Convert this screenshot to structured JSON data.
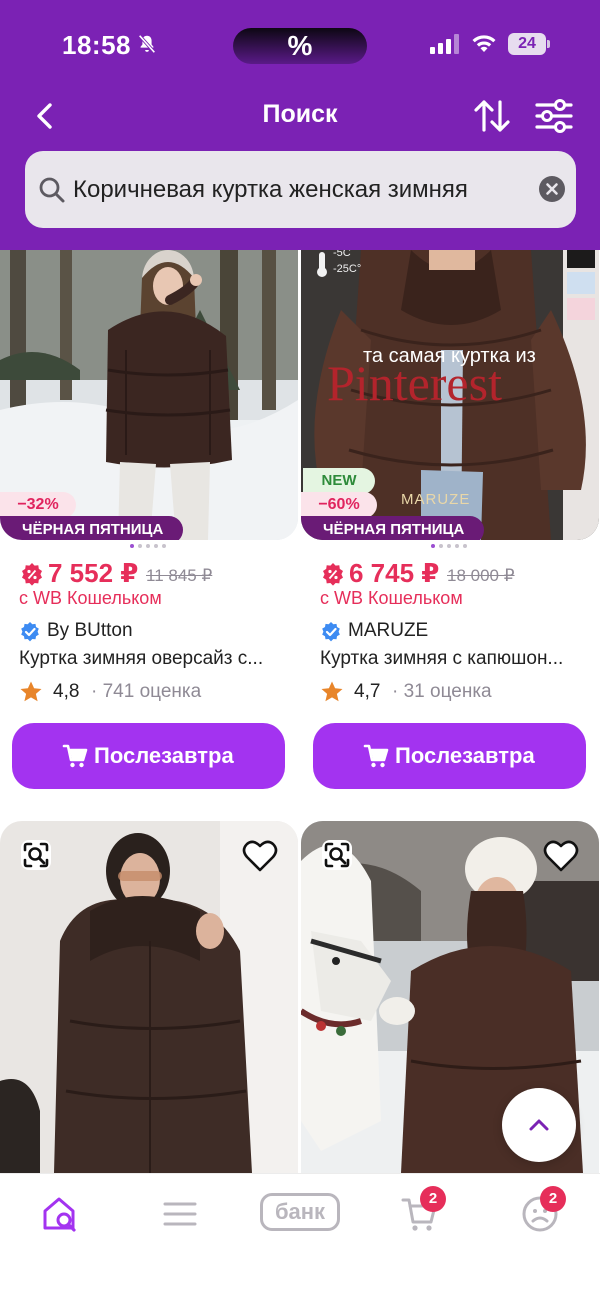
{
  "status_bar": {
    "time": "18:58",
    "battery": "24"
  },
  "promo_island": {
    "symbol": "%"
  },
  "header": {
    "title": "Поиск"
  },
  "search": {
    "query": "Коричневая куртка женская зимняя"
  },
  "products": [
    {
      "discount": "−32%",
      "promo_label": "ЧЁРНАЯ ПЯТНИЦА",
      "price": "7 552 ₽",
      "old_price": "11 845 ₽",
      "wallet_note": "с WB Кошельком",
      "brand": "By BUtton",
      "name": "Куртка зимняя оверсайз с...",
      "rating": "4,8",
      "reviews": "· 741 оценка",
      "button_label": "Послезавтра",
      "image_text": ""
    },
    {
      "new_label": "NEW",
      "discount": "−60%",
      "promo_label": "ЧЁРНАЯ ПЯТНИЦА",
      "price": "6 745 ₽",
      "old_price": "18 000 ₽",
      "wallet_note": "с WB Кошельком",
      "brand": "MARUZE",
      "name": "Куртка зимняя с капюшон...",
      "rating": "4,7",
      "reviews": "· 31 оценка",
      "button_label": "Послезавтра",
      "image_text": "та самая куртка из",
      "image_text_big": "Pinterest",
      "image_logo": "MARUZE",
      "image_temp_1": "-5C",
      "image_temp_2": "-25C°"
    }
  ],
  "bottom_nav": {
    "items": [
      "home",
      "catalog",
      "bank",
      "cart",
      "profile"
    ],
    "bank_label": "банк",
    "cart_count": "2",
    "profile_count": "2"
  },
  "colors": {
    "brand_purple": "#7b22b4",
    "button_purple": "#a333f0",
    "price_red": "#e62e5a"
  }
}
